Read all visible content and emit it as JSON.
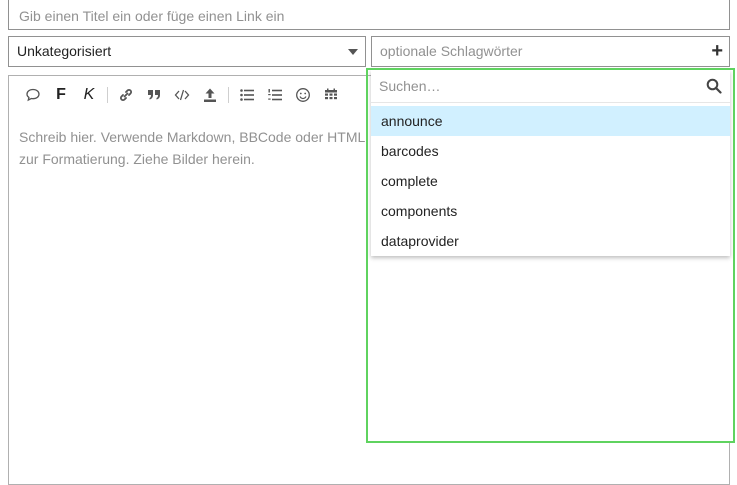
{
  "composer": {
    "title_placeholder": "Gib einen Titel ein oder füge einen Link ein",
    "category_value": "Unkategorisiert",
    "tags_placeholder": "optionale Schlagwörter",
    "editor_placeholder": "Schreib hier. Verwende Markdown, BBCode oder HTML zur Formatierung. Ziehe Bilder herein.",
    "toolbar": [
      {
        "icon": "speech-bubble-icon"
      },
      {
        "icon": "bold-icon",
        "glyph": "F"
      },
      {
        "icon": "italic-icon",
        "glyph": "K"
      },
      {
        "icon": "link-icon"
      },
      {
        "icon": "quote-icon"
      },
      {
        "icon": "code-icon"
      },
      {
        "icon": "upload-icon"
      },
      {
        "icon": "bullet-list-icon"
      },
      {
        "icon": "numbered-list-icon"
      },
      {
        "icon": "emoji-icon"
      },
      {
        "icon": "calendar-icon"
      }
    ]
  },
  "tag_dropdown": {
    "search_placeholder": "Suchen…",
    "items": [
      "announce",
      "barcodes",
      "complete",
      "components",
      "dataprovider"
    ],
    "highlighted_index": 0
  },
  "colors": {
    "highlight": "#d1f0ff",
    "focus_frame": "#5fd35f",
    "placeholder_text": "#919191",
    "border": "#919191"
  }
}
